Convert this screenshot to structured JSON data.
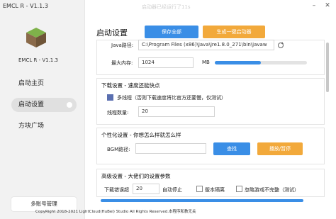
{
  "app": {
    "title": "EMCL R - V1.1.3",
    "version": "EMCL R - V1.1.3",
    "window_hint": "启动器已经运行了11s"
  },
  "sidebar": {
    "items": [
      {
        "label": "启动主页"
      },
      {
        "label": "启动设置"
      },
      {
        "label": "方块广场"
      }
    ],
    "account_button": "多账号管理"
  },
  "main": {
    "page_title": "启动设置",
    "save_all": "保存全部",
    "gen_launcher": "生成一键启动器"
  },
  "java": {
    "label": "Java路径:",
    "path": "C:\\Program Files (x86)\\Java\\jre1.8.0_271\\bin\\javaw",
    "memory_label": "最大内存:",
    "memory_value": "1024",
    "memory_unit": "MB",
    "memory_fill": 0.5
  },
  "download": {
    "heading": "下载设置 - 速度还能快点",
    "multithread_label": "多线程（否则下载速度将比官方还要慢，仅测试）",
    "multithread_checked": true,
    "thread_label": "线程数量:",
    "thread_value": "20"
  },
  "personal": {
    "heading": "个性化设置 - 你想怎么样就怎么样",
    "bgm_label": "BGM路径:",
    "bgm_value": "",
    "browse": "查找",
    "play_pause": "播放/暂停"
  },
  "advanced": {
    "heading": "高级设置 - 大佬们的设置参数",
    "retry_label": "下载错误超",
    "retry_value": "20",
    "auto_stop": "自动停止",
    "isolation": "版本隔离",
    "ignore_incomplete": "忽略游戏不完整（测试）"
  },
  "footer": "CopyRight 2018-2021 LightCloud(HuBei) Studio All Rights Reserved.本程序和教无关",
  "colors": {
    "accent": "#3a8ee6",
    "orange": "#f2a93b",
    "checkbox": "#5a6fb0"
  }
}
